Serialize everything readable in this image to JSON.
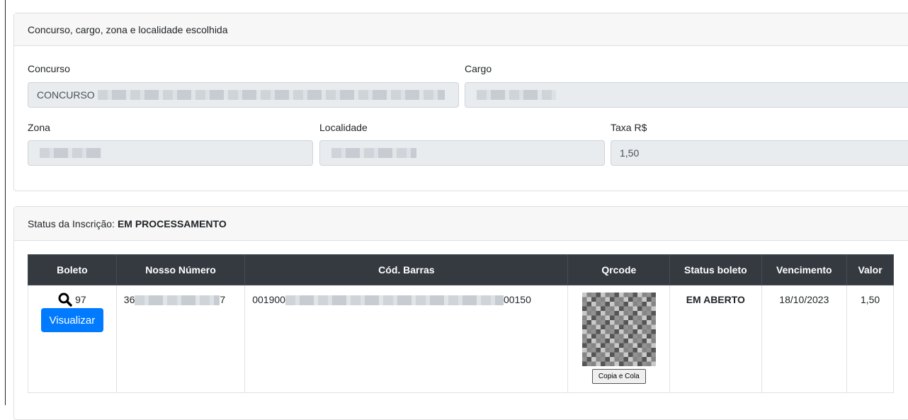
{
  "section1": {
    "header": "Concurso, cargo, zona e localidade escolhida",
    "concurso": {
      "label": "Concurso",
      "value": "CONCURSO"
    },
    "cargo": {
      "label": "Cargo",
      "value": ""
    },
    "zona": {
      "label": "Zona",
      "value": ""
    },
    "localidade": {
      "label": "Localidade",
      "value": ""
    },
    "taxa": {
      "label": "Taxa R$",
      "value": "1,50"
    }
  },
  "section2": {
    "status_prefix": "Status da Inscrição: ",
    "status_value": "EM PROCESSAMENTO",
    "table": {
      "headers": [
        "Boleto",
        "Nosso Número",
        "Cód. Barras",
        "Qrcode",
        "Status boleto",
        "Vencimento",
        "Valor"
      ],
      "row": {
        "boleto_number": "97",
        "view_button": "Visualizar",
        "nosso_numero_start": "36",
        "nosso_numero_end": "7",
        "barcode_start": "001900",
        "barcode_end": "00150",
        "copy_button": "Copia e Cola",
        "status": "EM ABERTO",
        "vencimento": "18/10/2023",
        "valor": "1,50"
      }
    }
  },
  "icons": {
    "search": "search-icon"
  }
}
